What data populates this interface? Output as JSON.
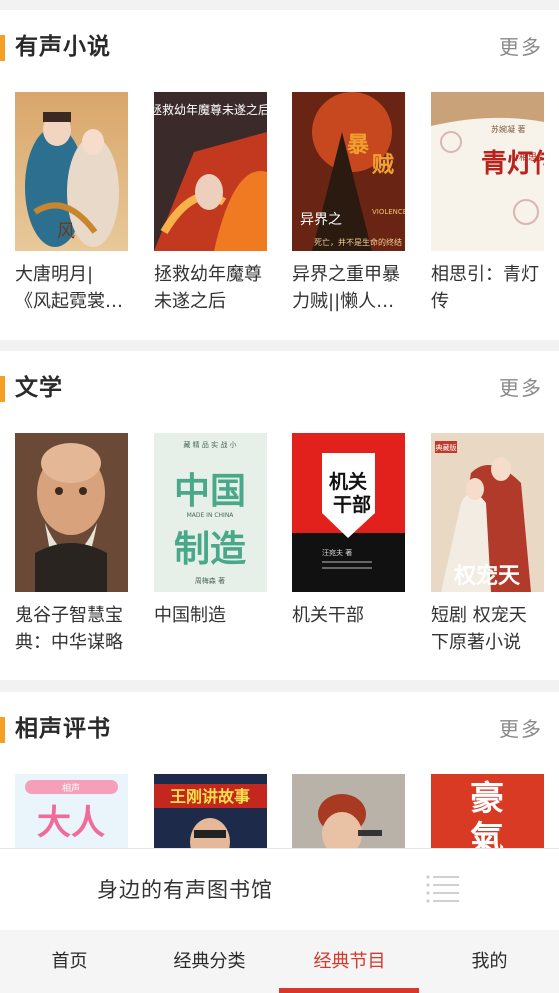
{
  "sections": [
    {
      "title": "有声小说",
      "more": "更多",
      "books": [
        {
          "title": "大唐明月|《风起霓裳》原著"
        },
        {
          "title": "拯救幼年魔尊未遂之后"
        },
        {
          "title": "异界之重甲暴力贼||懒人听书"
        },
        {
          "title": "相思引：青灯传"
        }
      ]
    },
    {
      "title": "文学",
      "more": "更多",
      "books": [
        {
          "title": "鬼谷子智慧宝典：中华谋略"
        },
        {
          "title": "中国制造"
        },
        {
          "title": "机关干部"
        },
        {
          "title": "短剧 权宠天下原著小说"
        }
      ]
    },
    {
      "title": "相声评书",
      "more": "更多",
      "books": [
        {
          "title": ""
        },
        {
          "title": ""
        },
        {
          "title": ""
        },
        {
          "title": ""
        }
      ]
    }
  ],
  "covers": {
    "c2": "拯救幼年魔尊未遂之后",
    "c3a": "异界之",
    "c3b": "暴",
    "c3c": "贼",
    "c3d": "VIOLENCE",
    "c3e": "死亡，并不是生命的终结",
    "c4a": "青灯传",
    "c4b": "相思引",
    "c4c": "苏婉凝 著",
    "c6a": "中国",
    "c6b": "制造",
    "c6c": "藏 精 品 实 战 小",
    "c6d": "MADE IN CHINA",
    "c6e": "周梅森 著",
    "c7a": "机关",
    "c7b": "干部",
    "c7c": "汪宛夫 著",
    "c8a": "权宠天",
    "c8b": "典藏版",
    "c9a": "大人",
    "c9b": "相声",
    "c10a": "王刚讲故事",
    "c12a": "豪",
    "c12b": "氣"
  },
  "player": {
    "title": "身边的有声图书馆",
    "icon": "playlist-icon"
  },
  "tabs": [
    {
      "label": "首页"
    },
    {
      "label": "经典分类"
    },
    {
      "label": "经典节目"
    },
    {
      "label": "我的"
    }
  ],
  "active_tab": 2,
  "colors": {
    "accent": "#f3a024",
    "active": "#d7372c",
    "background": "#f2f2f2"
  }
}
